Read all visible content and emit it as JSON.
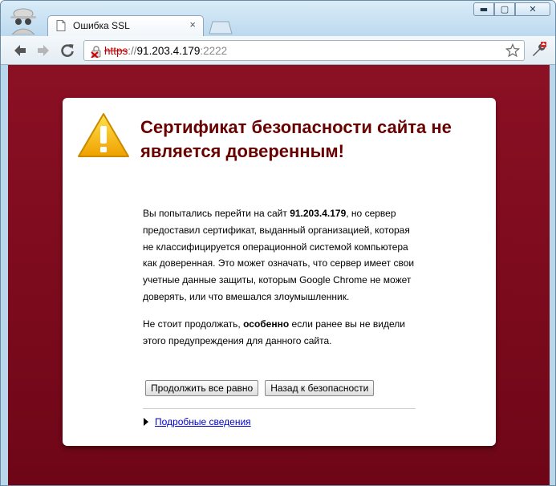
{
  "window": {
    "tab_title": "Ошибка SSL",
    "tab_close": "×",
    "minimize": "▬",
    "maximize": "▢",
    "close": "✕"
  },
  "omnibox": {
    "scheme": "https",
    "separator": "://",
    "host": "91.203.4.179",
    "port": ":2222"
  },
  "page": {
    "headline": "Сертификат безопасности сайта не является доверенным!",
    "para1_prefix": "Вы попытались перейти на сайт ",
    "para1_host": "91.203.4.179",
    "para1_rest": ", но сервер предоставил сертификат, выданный организацией, которая не классифицируется операционной системой компьютера как доверенная. Это может означать, что сервер имеет свои учетные данные защиты, которым Google Chrome не может доверять, или что вмешался злоумышленник.",
    "para2_prefix": "Не стоит продолжать, ",
    "para2_bold": "особенно",
    "para2_rest": " если ранее вы не видели этого предупреждения для данного сайта.",
    "proceed_button": "Продолжить все равно",
    "back_button": "Назад к безопасности",
    "details_link": "Подробные сведения"
  },
  "colors": {
    "background": "#7a0a1c",
    "headline": "#680000",
    "link": "#0000cc",
    "warning_icon": "#f5b800"
  },
  "icons": [
    "incognito-icon",
    "page-icon",
    "back-arrow-icon",
    "forward-arrow-icon",
    "reload-icon",
    "broken-lock-icon",
    "star-icon",
    "wrench-icon",
    "warning-icon"
  ]
}
